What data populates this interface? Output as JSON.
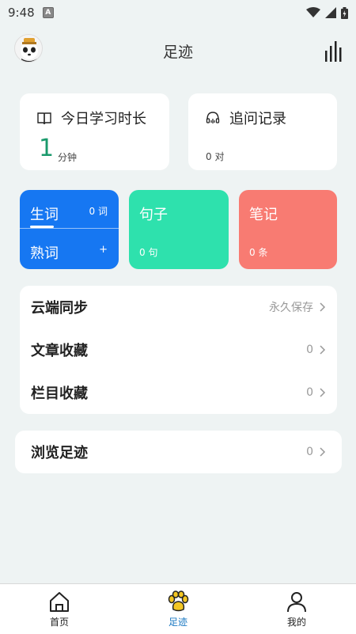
{
  "status_bar": {
    "time": "9:48",
    "notice_icon_letter": "A"
  },
  "header": {
    "title": "足迹"
  },
  "study_card": {
    "title": "今日学习时长",
    "value": "1",
    "unit": "分钟"
  },
  "followup_card": {
    "title": "追问记录",
    "value": "0 对"
  },
  "vocab_tile": {
    "new_label": "生词",
    "new_count": "0 词",
    "known_label": "熟词",
    "add": "+"
  },
  "sentence_tile": {
    "label": "句子",
    "count": "0 句"
  },
  "notes_tile": {
    "label": "笔记",
    "count": "0 条"
  },
  "list": {
    "items": [
      {
        "label": "云端同步",
        "value": "永久保存"
      },
      {
        "label": "文章收藏",
        "value": "0"
      },
      {
        "label": "栏目收藏",
        "value": "0"
      }
    ]
  },
  "browse": {
    "label": "浏览足迹",
    "value": "0"
  },
  "tabs": [
    {
      "label": "首页",
      "icon": "home-icon",
      "active": false
    },
    {
      "label": "足迹",
      "icon": "paw-icon",
      "active": true
    },
    {
      "label": "我的",
      "icon": "person-icon",
      "active": false
    }
  ],
  "colors": {
    "background": "#eef3f3",
    "vocab": "#1677f2",
    "sentence": "#2ee1ad",
    "notes": "#f87b72",
    "accent_green": "#1a9a6c",
    "active_tab": "#1a78c2",
    "paw": "#f3c623"
  }
}
